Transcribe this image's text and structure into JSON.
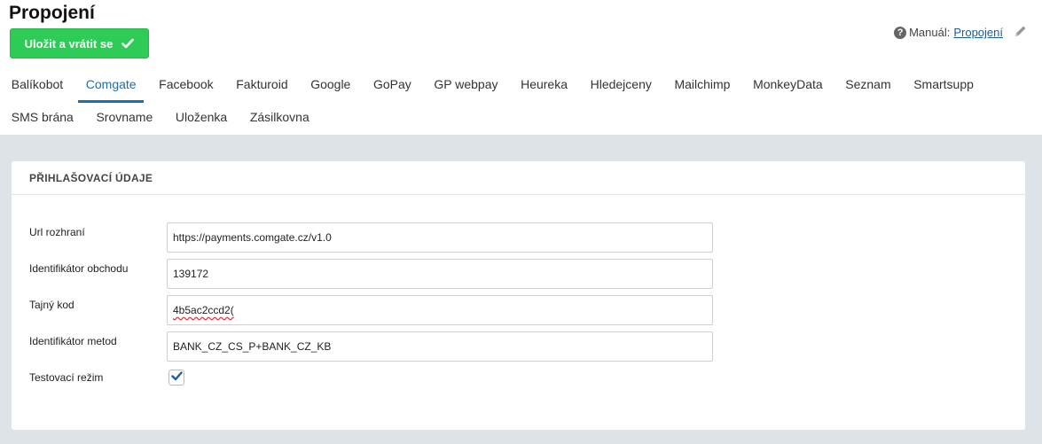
{
  "header": {
    "title": "Propojení",
    "save_label": "Uložit a vrátit se",
    "manual_label": "Manuál:",
    "manual_link": "Propojení"
  },
  "tabs": {
    "row1": [
      "Balíkobot",
      "Comgate",
      "Facebook",
      "Fakturoid",
      "Google",
      "GoPay",
      "GP webpay",
      "Heureka",
      "Hledejceny",
      "Mailchimp",
      "MonkeyData",
      "Seznam",
      "Smartsupp"
    ],
    "row2": [
      "SMS brána",
      "Srovname",
      "Uloženka",
      "Zásilkovna"
    ],
    "active": "Comgate"
  },
  "panel": {
    "title": "PŘIHLAŠOVACÍ ÚDAJE",
    "fields": [
      {
        "label": "Url rozhraní",
        "value": "https://payments.comgate.cz/v1.0"
      },
      {
        "label": "Identifikátor obchodu",
        "value": "139172"
      },
      {
        "label": "Tajný kod",
        "value": "4b5ac2ccd2("
      },
      {
        "label": "Identifikátor metod",
        "value": "BANK_CZ_CS_P+BANK_CZ_KB"
      }
    ],
    "checkbox_label": "Testovací režim",
    "checkbox_checked": true
  },
  "colors": {
    "save_button": "#2ecc57",
    "accent": "#1a6fb0",
    "background": "#dde3e6"
  },
  "icons": {
    "save": "check-icon",
    "help": "question-circle-icon",
    "edit": "pencil-icon"
  }
}
